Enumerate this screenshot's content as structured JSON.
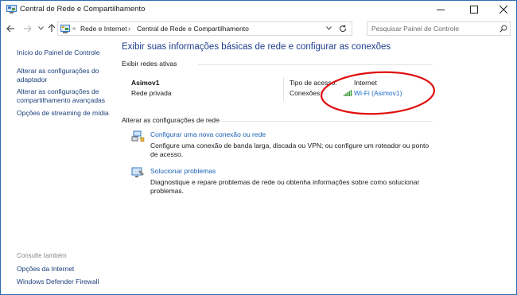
{
  "window": {
    "title": "Central de Rede e Compartilhamento"
  },
  "addressbar": {
    "crumb_prefix": "«",
    "crumb_1": "Rede e Internet",
    "crumb_separator": "›",
    "crumb_2": "Central de Rede e Compartilhamento",
    "search_placeholder": "Pesquisar Painel de Controle"
  },
  "sidebar": {
    "items": [
      {
        "label": "Início do Painel de Controle"
      },
      {
        "label": "Alterar as configurações do adaptador"
      },
      {
        "label": "Alterar as configurações de compartilhamento avançadas"
      },
      {
        "label": "Opções de streaming de mídia"
      }
    ],
    "see_also_title": "Consulte também",
    "see_also": [
      {
        "label": "Opções da Internet"
      },
      {
        "label": "Windows Defender Firewall"
      }
    ]
  },
  "main": {
    "heading": "Exibir suas informações básicas de rede e configurar as conexões",
    "active_networks_label": "Exibir redes ativas",
    "network": {
      "name": "Asimov1",
      "type": "Rede privada",
      "access_type_label": "Tipo de acesso:",
      "access_type_value": "Internet",
      "connections_label": "Conexões:",
      "connection_value": "Wi-Fi (Asimov1)"
    },
    "change_settings_label": "Alterar as configurações de rede",
    "tasks": [
      {
        "title": "Configurar uma nova conexão ou rede",
        "description": "Configure uma conexão de banda larga, discada ou VPN; ou configure um roteador ou ponto de acesso."
      },
      {
        "title": "Solucionar problemas",
        "description": "Diagnostique e repare problemas de rede ou obtenha informações sobre como solucionar problemas."
      }
    ]
  },
  "colors": {
    "heading": "#1e3d8c",
    "link": "#1a5fb4",
    "annotation": "#e01010"
  }
}
